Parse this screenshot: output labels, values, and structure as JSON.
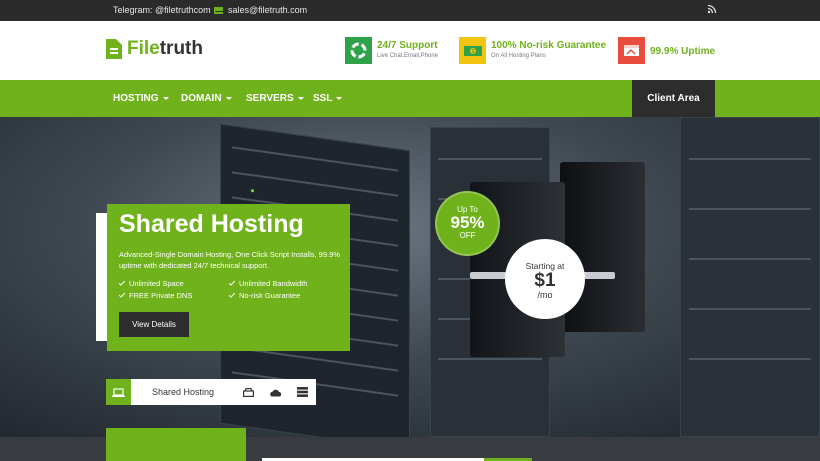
{
  "topbar": {
    "telegram": "Telegram: @filetruthcom",
    "email": "sales@filetruth.com"
  },
  "logo": {
    "part1": "File",
    "part2": "truth"
  },
  "features": [
    {
      "title": "24/7 Support",
      "subtitle": "Live Chat,Email,Phone"
    },
    {
      "title": "100% No-risk Guarantee",
      "subtitle": "On All Hosting Plans"
    },
    {
      "title": "99.9% Uptime",
      "subtitle": ""
    }
  ],
  "nav": {
    "items": [
      "HOSTING",
      "DOMAIN",
      "SERVERS",
      "SSL"
    ],
    "client_area": "Client Area"
  },
  "hero": {
    "title": "Shared Hosting",
    "description": "Advanced-Single Domain Hosting, One Click Script Installs, 99.9% uptime with dedicated 24/7 technical support.",
    "features": [
      "Unlimited Space",
      "Unlimited Bandwidth",
      "FREE Private DNS",
      "No-risk Guarantee"
    ],
    "button": "View Details",
    "badge": {
      "line1": "Up To",
      "line2": "95%",
      "line3": "OFF"
    },
    "price": {
      "line1": "Starting at",
      "line2": "$1",
      "line3": "/mo"
    }
  },
  "tabs": {
    "active_label": "Shared Hosting"
  },
  "colors": {
    "brand_green": "#6fb21b",
    "dark": "#2d2d2d"
  }
}
